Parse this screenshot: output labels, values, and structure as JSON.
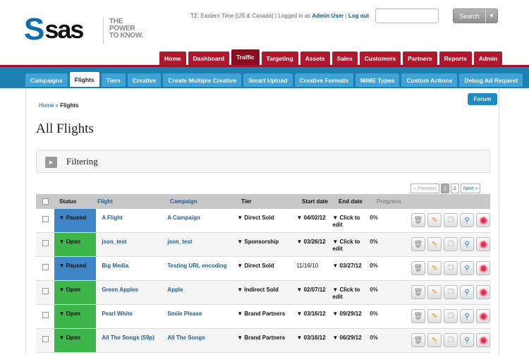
{
  "header": {
    "logo_mark": "S",
    "logo_text": "sas",
    "tagline": [
      "THE",
      "POWER",
      "TO KNOW."
    ],
    "user_info": {
      "timezone": "TZ: Eastern Time (US & Canada) | Logged in as",
      "user": "Admin User",
      "separator": "|",
      "logout": "Log out"
    },
    "search": {
      "value": "",
      "button_label": "Search",
      "dropdown_icon": "triangle-down-icon"
    }
  },
  "topnav": {
    "items": [
      "Home",
      "Dashboard",
      "Traffic",
      "Targeting",
      "Assets",
      "Sales",
      "Customers",
      "Partners",
      "Reports",
      "Admin"
    ],
    "active": "Traffic"
  },
  "subnav": {
    "items": [
      "Campaigns",
      "Flights",
      "Tiers",
      "Creative",
      "Create Multiple Creative",
      "Smart Upload",
      "Creative Formats",
      "MIME Types",
      "Custom Actions",
      "Debug Ad Request"
    ],
    "active": "Flights"
  },
  "breadcrumb": {
    "home": "Home",
    "sep": "»",
    "current": "Flights"
  },
  "forum_label": "Forum",
  "page_title": "All Flights",
  "filter": {
    "label": "Filtering"
  },
  "pager": {
    "prev": "« Previous",
    "pages": [
      "1",
      "2"
    ],
    "next": "Next »",
    "current": "1"
  },
  "table": {
    "columns": [
      "Status",
      "Flight",
      "Campaign",
      "Tier",
      "Start date",
      "End date",
      "Progress"
    ],
    "rows": [
      {
        "status": "▼ Paused",
        "flight": "A Flight",
        "campaign": "A Campaign",
        "tier": "▼ Direct Sold",
        "start": "▼ 04/02/12",
        "end": "▼ Click to edit",
        "progress": "0%",
        "start_plain": false
      },
      {
        "status": "▼ Open",
        "flight": "json_test",
        "campaign": "json_test",
        "tier": "▼ Sponsorship",
        "start": "▼ 03/26/12",
        "end": "▼ Click to edit",
        "progress": "0%",
        "start_plain": false
      },
      {
        "status": "▼ Paused",
        "flight": "Big Media",
        "campaign": "Testing URL encoding",
        "tier": "▼ Direct Sold",
        "start": "11/16/10",
        "end": "▼ 03/27/12",
        "progress": "0%",
        "start_plain": true
      },
      {
        "status": "▼ Open",
        "flight": "Green Apples",
        "campaign": "Apple",
        "tier": "▼ Indirect Sold",
        "start": "▼ 02/07/12",
        "end": "▼ Click to edit",
        "progress": "0%",
        "start_plain": false
      },
      {
        "status": "▼ Open",
        "flight": "Pearl White",
        "campaign": "Smile Please",
        "tier": "▼ Brand Partners",
        "start": "▼ 03/16/12",
        "end": "▼ 09/29/12",
        "progress": "0%",
        "start_plain": false
      },
      {
        "status": "▼ Open",
        "flight": "All The Songs (59p)",
        "campaign": "All The Songs",
        "tier": "▼ Brand Partners",
        "start": "▼ 03/16/12",
        "end": "▼ 06/29/12",
        "progress": "0%",
        "start_plain": false
      }
    ],
    "action_icons": [
      "trash-icon",
      "pencil-icon",
      "copy-icon",
      "magnifier-icon",
      "stop-icon"
    ]
  },
  "colors": {
    "brand_red": "#b0182e",
    "subnav_blue": "#1d7fb0",
    "paused": "#3e86c8",
    "open": "#3db54a",
    "link": "#1f6096"
  }
}
